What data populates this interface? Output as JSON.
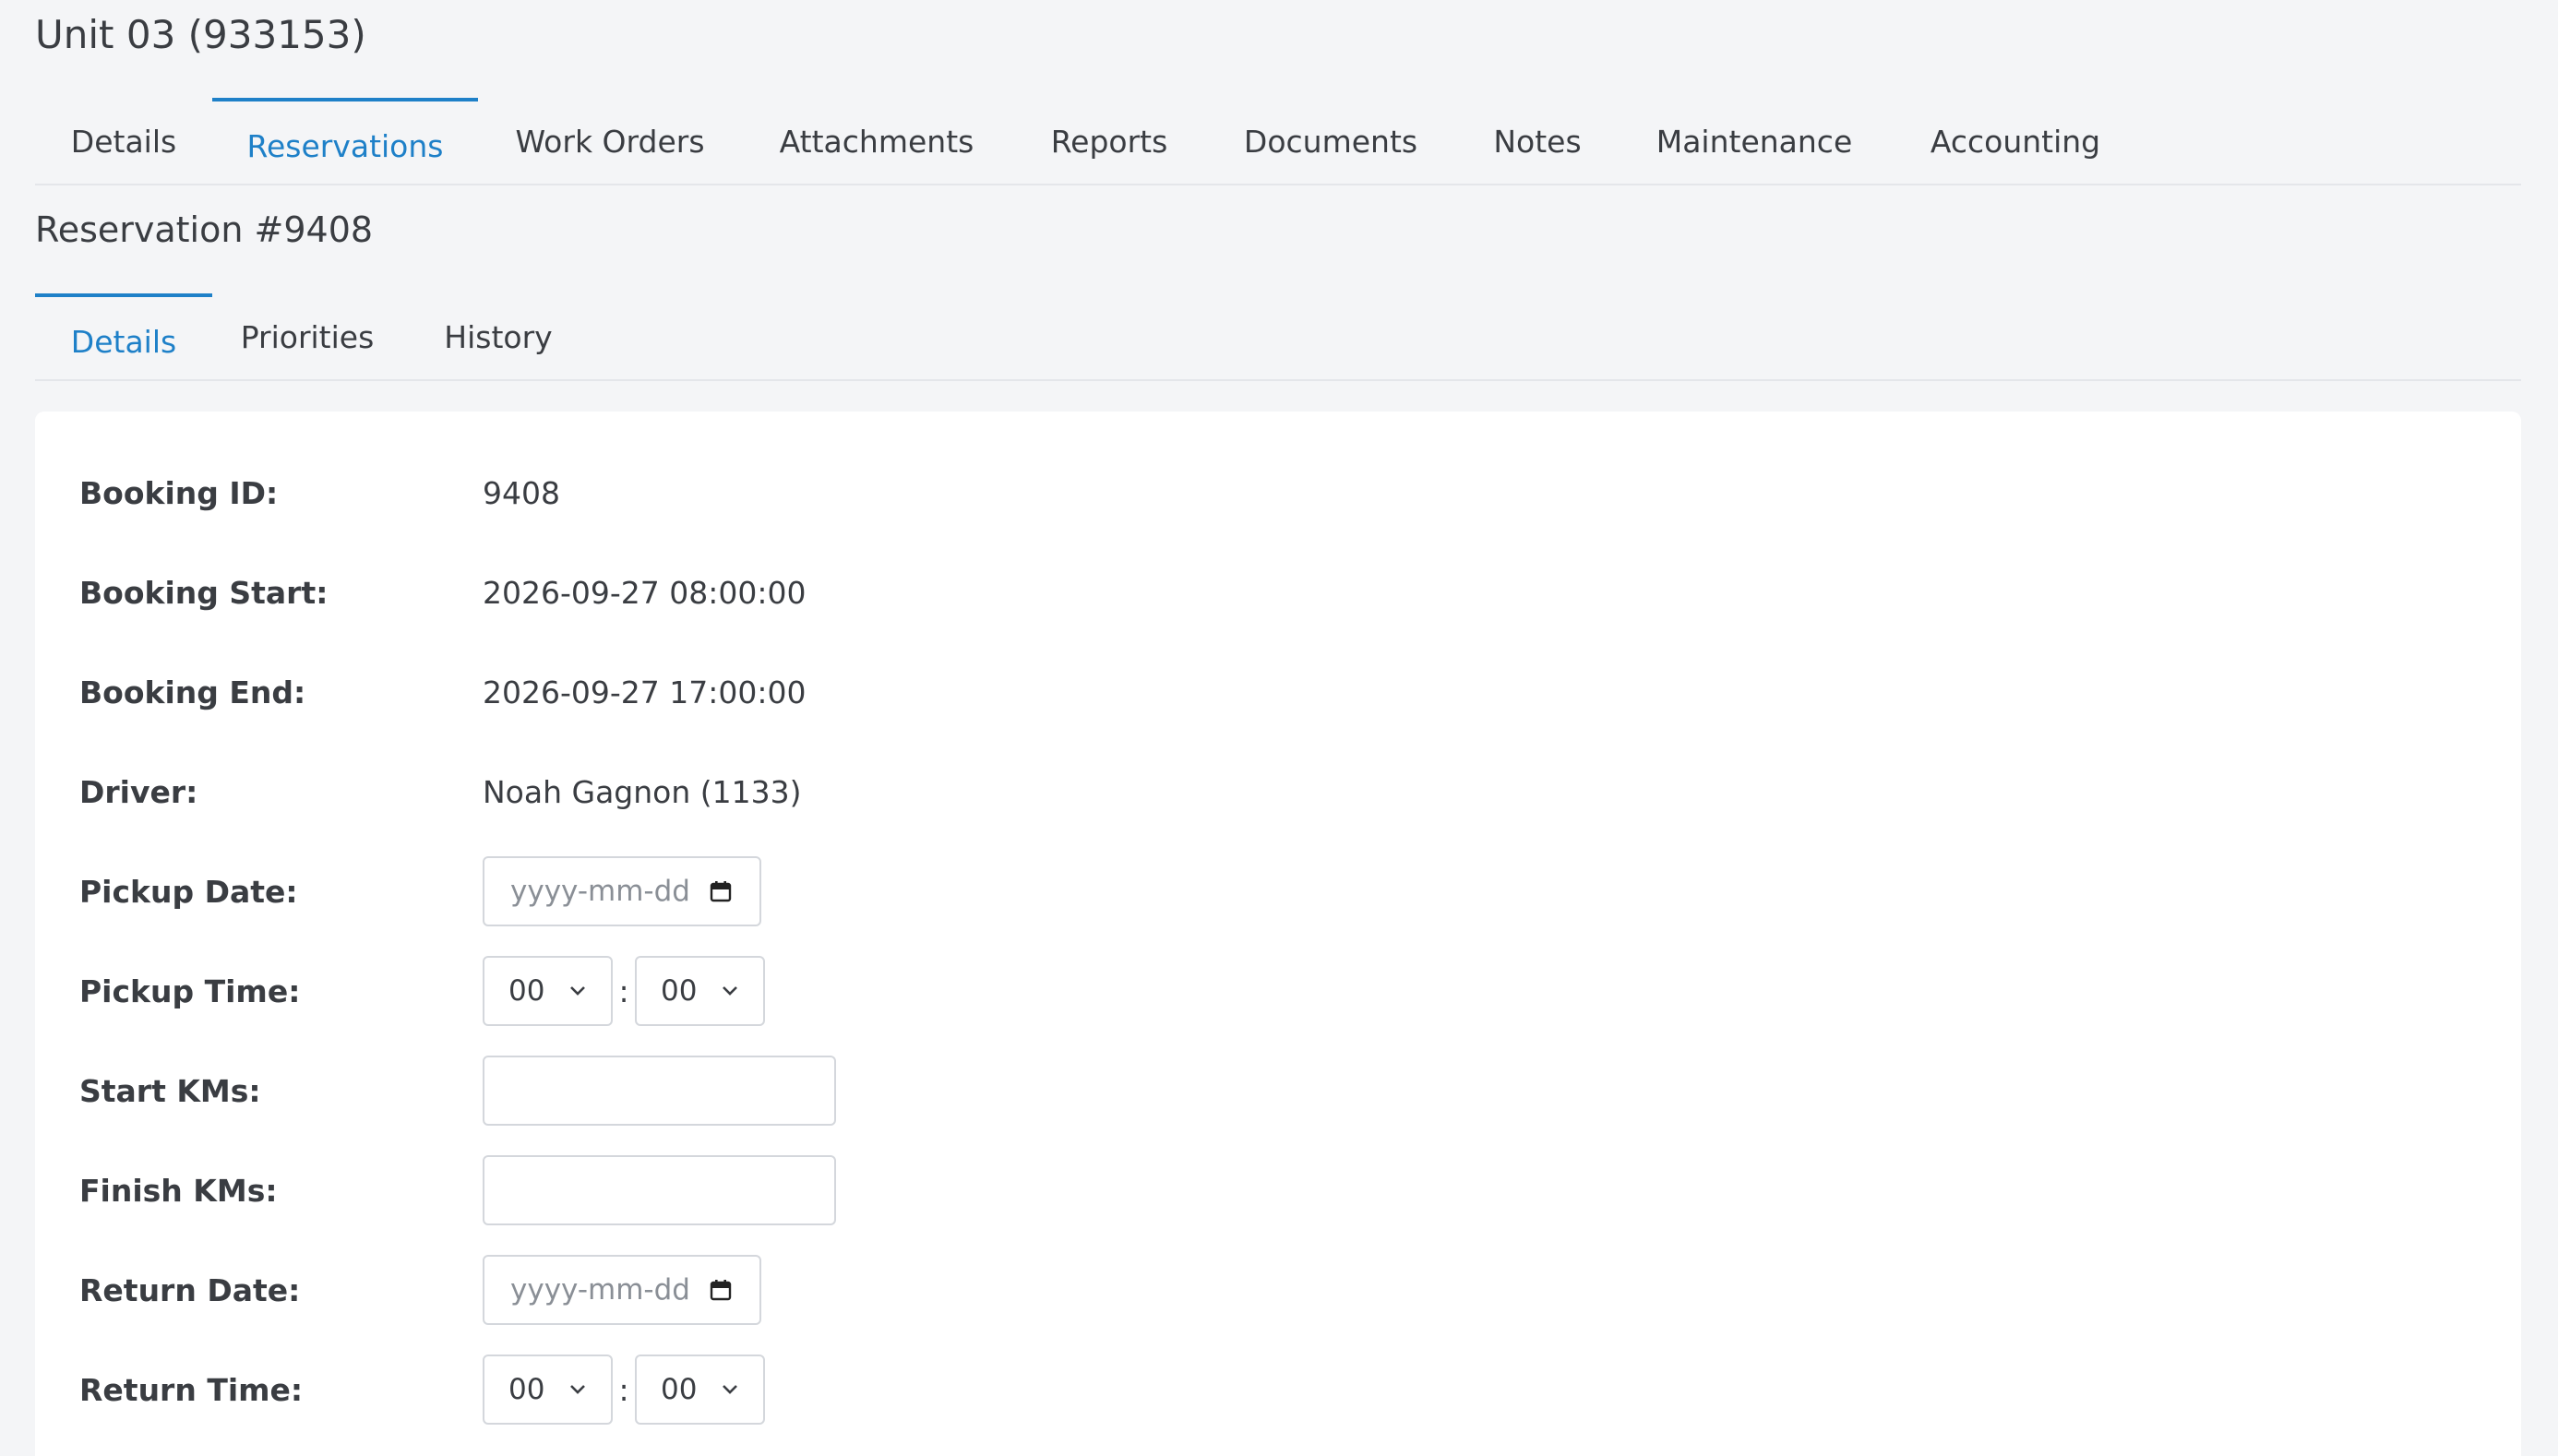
{
  "unit": {
    "title": "Unit 03 (933153)"
  },
  "tabs": [
    {
      "label": "Details"
    },
    {
      "label": "Reservations"
    },
    {
      "label": "Work Orders"
    },
    {
      "label": "Attachments"
    },
    {
      "label": "Reports"
    },
    {
      "label": "Documents"
    },
    {
      "label": "Notes"
    },
    {
      "label": "Maintenance"
    },
    {
      "label": "Accounting"
    }
  ],
  "active_tab": "Reservations",
  "reservation": {
    "title": "Reservation #9408"
  },
  "subtabs": [
    {
      "label": "Details"
    },
    {
      "label": "Priorities"
    },
    {
      "label": "History"
    }
  ],
  "active_subtab": "Details",
  "fields": {
    "booking_id": {
      "label": "Booking ID:",
      "value": "9408"
    },
    "booking_start": {
      "label": "Booking Start:",
      "value": "2026-09-27 08:00:00"
    },
    "booking_end": {
      "label": "Booking End:",
      "value": "2026-09-27 17:00:00"
    },
    "driver": {
      "label": "Driver:",
      "value": "Noah Gagnon (1133)"
    },
    "pickup_date": {
      "label": "Pickup Date:",
      "placeholder": "yyyy-mm-dd"
    },
    "pickup_time": {
      "label": "Pickup Time:",
      "hour": "00",
      "minute": "00",
      "separator": ":"
    },
    "start_kms": {
      "label": "Start KMs:",
      "value": ""
    },
    "finish_kms": {
      "label": "Finish KMs:",
      "value": ""
    },
    "return_date": {
      "label": "Return Date:",
      "placeholder": "yyyy-mm-dd"
    },
    "return_time": {
      "label": "Return Time:",
      "hour": "00",
      "minute": "00",
      "separator": ":"
    }
  },
  "colors": {
    "accent": "#1e80c8",
    "background": "#f4f5f7",
    "card": "#ffffff"
  },
  "icons": {
    "date": "calendar-icon",
    "select": "chevron-down-icon"
  }
}
